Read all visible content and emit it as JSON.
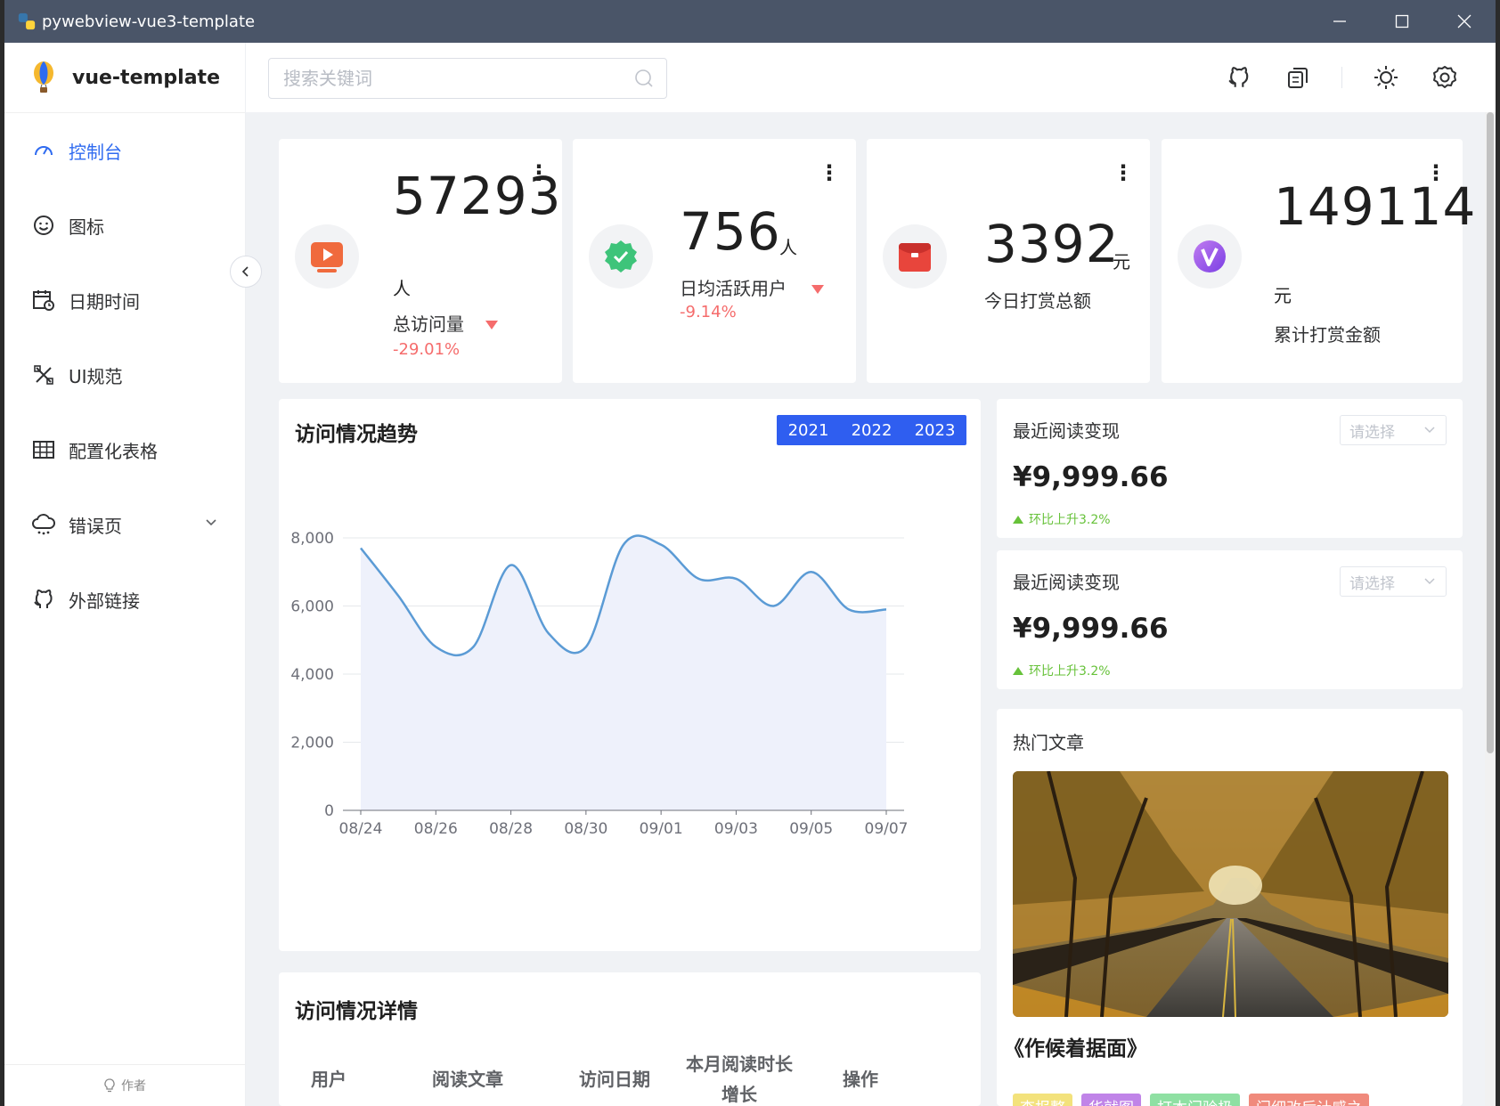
{
  "window": {
    "title": "pywebview-vue3-template"
  },
  "sidebar": {
    "brand": "vue-template",
    "items": [
      {
        "label": "控制台",
        "icon": "dashboard-icon",
        "active": true
      },
      {
        "label": "图标",
        "icon": "smile-icon"
      },
      {
        "label": "日期时间",
        "icon": "calendar-icon"
      },
      {
        "label": "UI规范",
        "icon": "design-icon"
      },
      {
        "label": "配置化表格",
        "icon": "table-icon"
      },
      {
        "label": "错误页",
        "icon": "cloud-icon",
        "has_children": true
      },
      {
        "label": "外部链接",
        "icon": "github-icon"
      }
    ],
    "footer": "作者"
  },
  "header": {
    "search_placeholder": "搜索关键词",
    "icons": [
      "github-icon",
      "copy-icon",
      "sun-icon",
      "settings-icon"
    ]
  },
  "stats": [
    {
      "value": "57293",
      "unit": "人",
      "label": "总访问量",
      "change": "-29.01%",
      "icon": "video-play-icon",
      "icon_color": "#f06a3d"
    },
    {
      "value": "756",
      "unit": "人",
      "label": "日均活跃用户",
      "change": "-9.14%",
      "icon": "verified-badge-icon",
      "icon_color": "#3ec47a"
    },
    {
      "value": "3392",
      "unit": "元",
      "label": "今日打赏总额",
      "change": "",
      "icon": "red-envelope-icon",
      "icon_color": "#e8453c"
    },
    {
      "value": "149114",
      "unit": "元",
      "label": "累计打赏金额",
      "change": "",
      "icon": "v-badge-icon",
      "icon_color": "#9b59e8"
    }
  ],
  "trend": {
    "title": "访问情况趋势",
    "years": [
      "2021",
      "2022",
      "2023"
    ]
  },
  "chart_data": {
    "type": "area",
    "x": [
      "08/24",
      "08/25",
      "08/26",
      "08/27",
      "08/28",
      "08/29",
      "08/30",
      "08/31",
      "09/01",
      "09/02",
      "09/03",
      "09/04",
      "09/05",
      "09/06",
      "09/07"
    ],
    "x_tick_labels": [
      "08/24",
      "08/26",
      "08/28",
      "08/30",
      "09/01",
      "09/03",
      "09/05",
      "09/07"
    ],
    "series": [
      {
        "values": [
          7700,
          6300,
          4800,
          4800,
          7200,
          5200,
          4800,
          7800,
          7800,
          6800,
          6800,
          6000,
          7000,
          5900,
          5900
        ]
      }
    ],
    "y_ticks": [
      "0",
      "2,000",
      "4,000",
      "6,000",
      "8,000"
    ],
    "ylim": [
      0,
      8000
    ],
    "grid": true,
    "line_color": "#5b9bd5",
    "fill_color": "#eef1fb"
  },
  "income_cards": [
    {
      "title": "最近阅读变现",
      "select_placeholder": "请选择",
      "amount": "¥9,999.66",
      "trend": "环比上升3.2%"
    },
    {
      "title": "最近阅读变现",
      "select_placeholder": "请选择",
      "amount": "¥9,999.66",
      "trend": "环比上升3.2%"
    }
  ],
  "hot": {
    "title": "热门文章",
    "article_title": "《作候着据面》",
    "tags": [
      {
        "label": "查报整",
        "color": "#f3e27c"
      },
      {
        "label": "华就图",
        "color": "#c084e8"
      },
      {
        "label": "打本门验极",
        "color": "#8fe0a3"
      },
      {
        "label": "门细改后计感之",
        "color": "#f08a7c"
      }
    ]
  },
  "details": {
    "title": "访问情况详情",
    "columns": [
      "用户",
      "阅读文章",
      "访问日期",
      "本月阅读时长增长",
      "操作"
    ]
  }
}
